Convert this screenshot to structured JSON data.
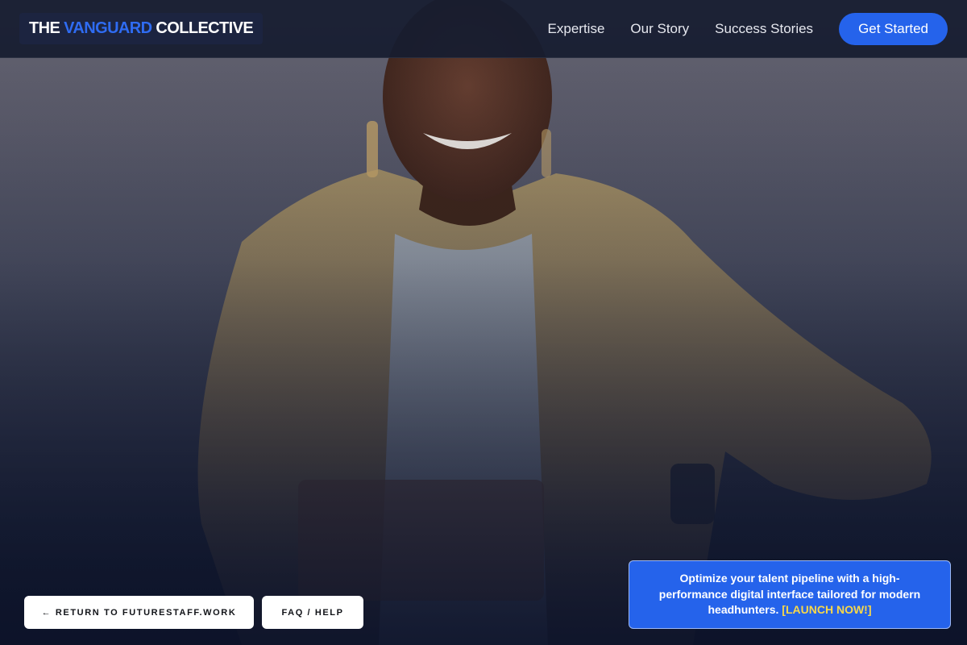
{
  "header": {
    "logo": {
      "part1": "THE ",
      "accent": "VANGUARD",
      "part2": " COLLECTIVE"
    },
    "nav": [
      "Expertise",
      "Our Story",
      "Success Stories"
    ],
    "cta_label": "Get Started"
  },
  "footer_buttons": {
    "return_label": "← RETURN TO FUTURESTAFF.WORK",
    "faq_label": "FAQ / HELP"
  },
  "promo": {
    "text": "Optimize your talent pipeline with a high-performance digital interface tailored for modern headhunters.",
    "link": "[LAUNCH NOW!]"
  },
  "colors": {
    "accent": "#2563eb",
    "logo_accent": "#2f6cf2",
    "launch_highlight": "#f8d84a",
    "header_bg": "#161c30"
  }
}
